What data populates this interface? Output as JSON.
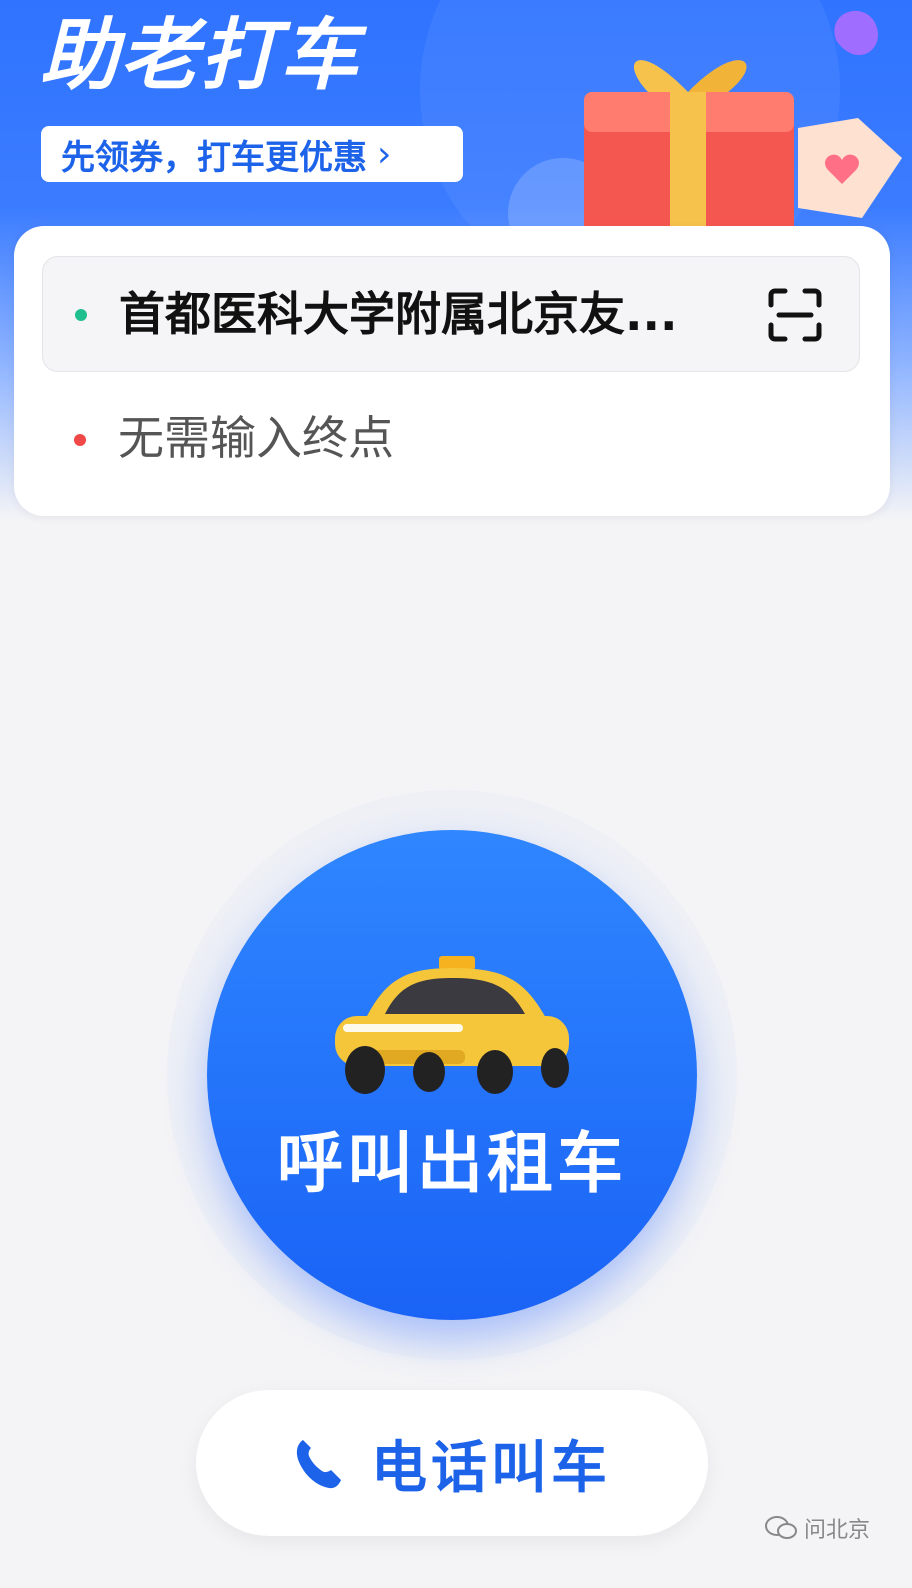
{
  "header": {
    "title": "助老打车",
    "coupon_text": "先领券，打车更优惠",
    "coupon_chevron": "›"
  },
  "route": {
    "from": "首都医科大学附属北京友...",
    "to_placeholder": "无需输入终点"
  },
  "actions": {
    "call_taxi": "呼叫出租车",
    "phone_call": "电话叫车"
  },
  "watermark": "问北京",
  "colors": {
    "brand_blue": "#1d63ea",
    "origin_dot": "#1fbf8f",
    "destination_dot": "#f04848",
    "taxi_yellow": "#f5c53a"
  },
  "icons": [
    "gift-icon",
    "scan-icon",
    "taxi-icon",
    "phone-icon",
    "wechat-icon"
  ]
}
